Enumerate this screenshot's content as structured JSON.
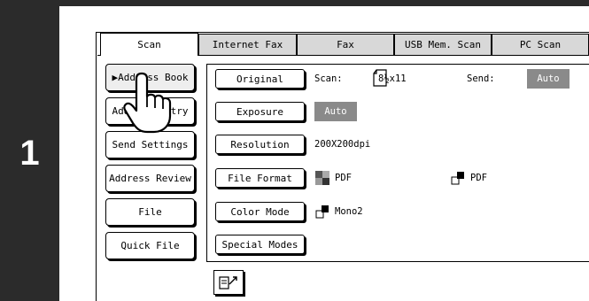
{
  "step": {
    "number": "1"
  },
  "tabs": [
    {
      "label": "Scan",
      "active": true
    },
    {
      "label": "Internet Fax",
      "active": false
    },
    {
      "label": "Fax",
      "active": false
    },
    {
      "label": "USB Mem. Scan",
      "active": false
    },
    {
      "label": "PC Scan",
      "active": false
    }
  ],
  "left_buttons": [
    {
      "label": "▶Address Book",
      "selected": true
    },
    {
      "label": "Address Entry"
    },
    {
      "label": "Send Settings"
    },
    {
      "label": "Address Review"
    },
    {
      "label": "File"
    },
    {
      "label": "Quick File"
    }
  ],
  "settings": {
    "original": {
      "button": "Original",
      "scan_label": "Scan:",
      "scan_value": "8½x11",
      "send_label": "Send:",
      "send_value": "Auto"
    },
    "exposure": {
      "button": "Exposure",
      "value": "Auto"
    },
    "resolution": {
      "button": "Resolution",
      "value": "200X200dpi"
    },
    "file_format": {
      "button": "File Format",
      "color_value": "PDF",
      "mono_value": "PDF"
    },
    "color_mode": {
      "button": "Color Mode",
      "value": "Mono2"
    },
    "special_modes": {
      "button": "Special Modes"
    }
  },
  "colors": {
    "frame": "#2b2b2b",
    "auto_badge": "#8a8a8a"
  },
  "icons": {
    "pointer": "hand-pointer-icon",
    "footer": "document-send-icon"
  }
}
